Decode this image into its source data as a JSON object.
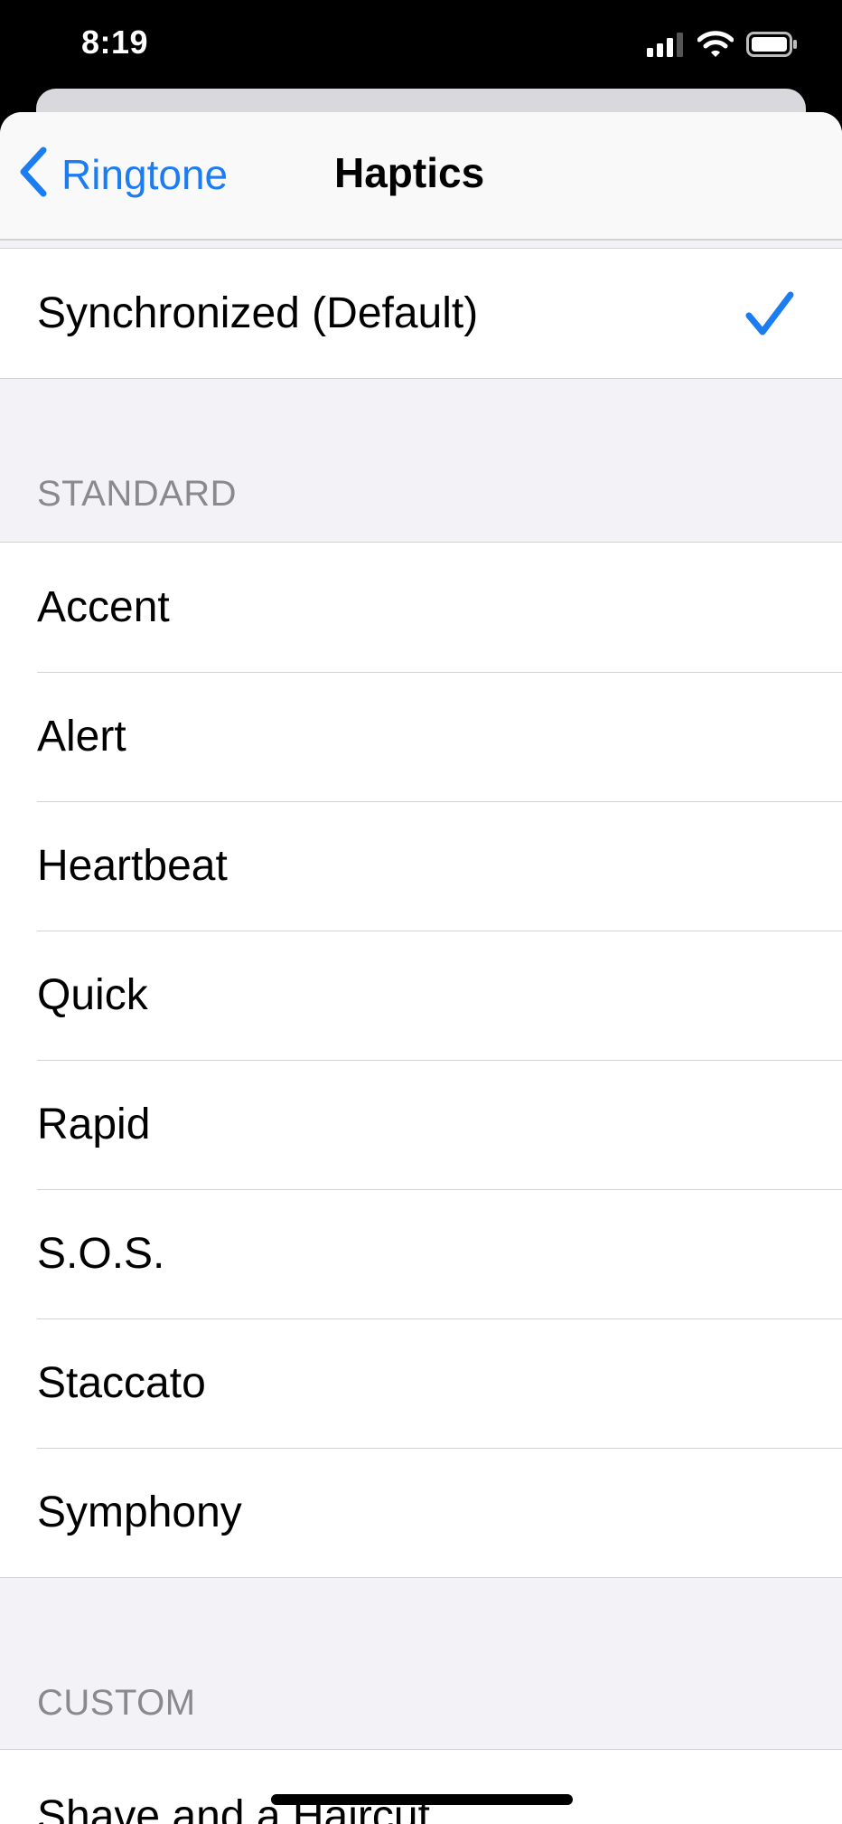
{
  "status_bar": {
    "time": "8:19",
    "icons": [
      "cellular-signal-icon",
      "wifi-icon",
      "battery-icon"
    ]
  },
  "nav": {
    "back_label": "Ringtone",
    "title": "Haptics",
    "accent_color": "#1c7cf2"
  },
  "selected_group": {
    "items": [
      {
        "label": "Synchronized (Default)",
        "selected": true
      }
    ]
  },
  "standard": {
    "header": "STANDARD",
    "items": [
      "Accent",
      "Alert",
      "Heartbeat",
      "Quick",
      "Rapid",
      "S.O.S.",
      "Staccato",
      "Symphony"
    ]
  },
  "custom": {
    "header": "CUSTOM",
    "items": [
      "Shave and a Haircut"
    ]
  }
}
